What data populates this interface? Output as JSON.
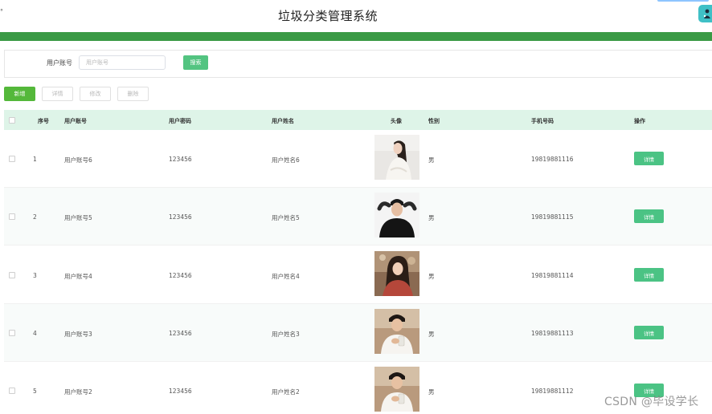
{
  "header": {
    "title": "垃圾分类管理系统",
    "corner_mark": "°"
  },
  "colors": {
    "brand_green": "#3a9a45",
    "table_header_bg": "#def4e8",
    "action_green": "#4bc384",
    "add_green": "#54b83a",
    "avatar_teal": "#3fc0c6"
  },
  "search": {
    "label": "用户账号",
    "placeholder": "用户账号",
    "value": "",
    "button_label": "搜索"
  },
  "toolbar": {
    "add_label": "新增",
    "detail_label": "详情",
    "edit_label": "修改",
    "delete_label": "删除"
  },
  "table": {
    "columns": [
      "序号",
      "用户账号",
      "用户密码",
      "用户姓名",
      "头像",
      "性别",
      "手机号码",
      "操作"
    ],
    "rows": [
      {
        "index": "1",
        "account": "用户账号6",
        "password": "123456",
        "name": "用户姓名6",
        "avatar": "woman-white-dress-photo",
        "gender": "男",
        "phone": "19819881116",
        "action": "详情"
      },
      {
        "index": "2",
        "account": "用户账号5",
        "password": "123456",
        "name": "用户姓名5",
        "avatar": "man-black-shirt-photo",
        "gender": "男",
        "phone": "19819881115",
        "action": "详情"
      },
      {
        "index": "3",
        "account": "用户账号4",
        "password": "123456",
        "name": "用户姓名4",
        "avatar": "woman-red-top-photo",
        "gender": "男",
        "phone": "19819881114",
        "action": "详情"
      },
      {
        "index": "4",
        "account": "用户账号3",
        "password": "123456",
        "name": "用户姓名3",
        "avatar": "man-white-shirt-drink-photo",
        "gender": "男",
        "phone": "19819881113",
        "action": "详情"
      },
      {
        "index": "5",
        "account": "用户账号2",
        "password": "123456",
        "name": "用户姓名2",
        "avatar": "man-white-shirt-drink-photo",
        "gender": "男",
        "phone": "19819881112",
        "action": "详情"
      }
    ]
  },
  "watermark": "CSDN @毕设学长"
}
